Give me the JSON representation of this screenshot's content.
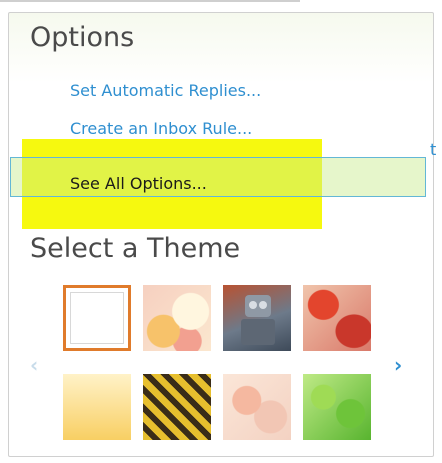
{
  "options": {
    "heading": "Options",
    "links": {
      "automatic_replies": "Set Automatic Replies...",
      "inbox_rule": "Create an Inbox Rule...",
      "see_all": "See All Options..."
    },
    "edge_fragment": "t"
  },
  "theme": {
    "heading": "Select a Theme",
    "prev_arrow": "‹",
    "next_arrow": "›",
    "thumbnails": [
      "default",
      "peach-circles",
      "robot",
      "autumn-leaves",
      "yellow-gradient",
      "striped-bee",
      "pink-flowers",
      "green-leaves"
    ],
    "selected_index": 0
  },
  "colors": {
    "link": "#2f8fd0",
    "selection_border": "#e07b2b",
    "highlight": "#f6f90f",
    "focus_border": "#63b7d6"
  }
}
